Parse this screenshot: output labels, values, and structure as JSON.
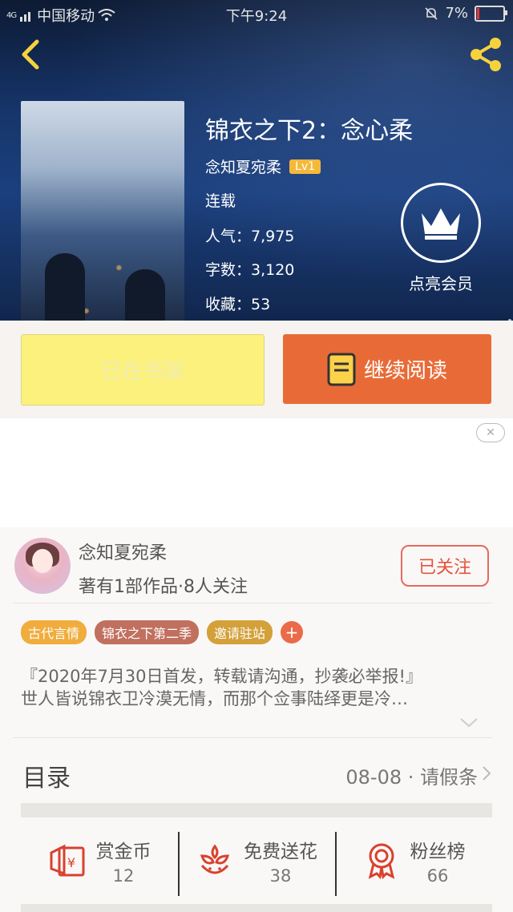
{
  "status_bar": {
    "signal": "4G",
    "carrier": "中国移动",
    "time": "下午9:24",
    "battery": "7%"
  },
  "book": {
    "title": "锦衣之下2：念心柔",
    "author": "念知夏宛柔",
    "level": "Lv1",
    "status": "连载",
    "popularity_label": "人气：7,975",
    "words_label": "字数：3,120",
    "favorites_label": "收藏：53"
  },
  "vip": {
    "label": "点亮会员"
  },
  "actions": {
    "shelf_label": "已在书架",
    "read_label": "继续阅读"
  },
  "author_card": {
    "name": "念知夏宛柔",
    "stats": "著有1部作品·8人关注",
    "follow_label": "已关注"
  },
  "tags": [
    {
      "label": "古代言情",
      "color": "#f0ad3d"
    },
    {
      "label": "锦衣之下第二季",
      "color": "#c1705f"
    },
    {
      "label": "邀请驻站",
      "color": "#d3a03a"
    }
  ],
  "description": {
    "line1": "『2020年7月30日首发，转载请沟通，抄袭必举报!』",
    "line2": "世人皆说锦衣卫冷漠无情，而那个佥事陆绎更是冷…"
  },
  "toc": {
    "label": "目录",
    "latest": "08-08 · 请假条"
  },
  "stats": [
    {
      "label": "赏金币",
      "value": "12",
      "icon": "red-envelope-icon"
    },
    {
      "label": "免费送花",
      "value": "38",
      "icon": "flower-icon"
    },
    {
      "label": "粉丝榜",
      "value": "66",
      "icon": "medal-icon"
    }
  ],
  "colors": {
    "accent_orange": "#e86b37",
    "shelf_yellow": "#fbf17c",
    "follow_red": "#e4533f",
    "icon_red": "#d9412f"
  }
}
